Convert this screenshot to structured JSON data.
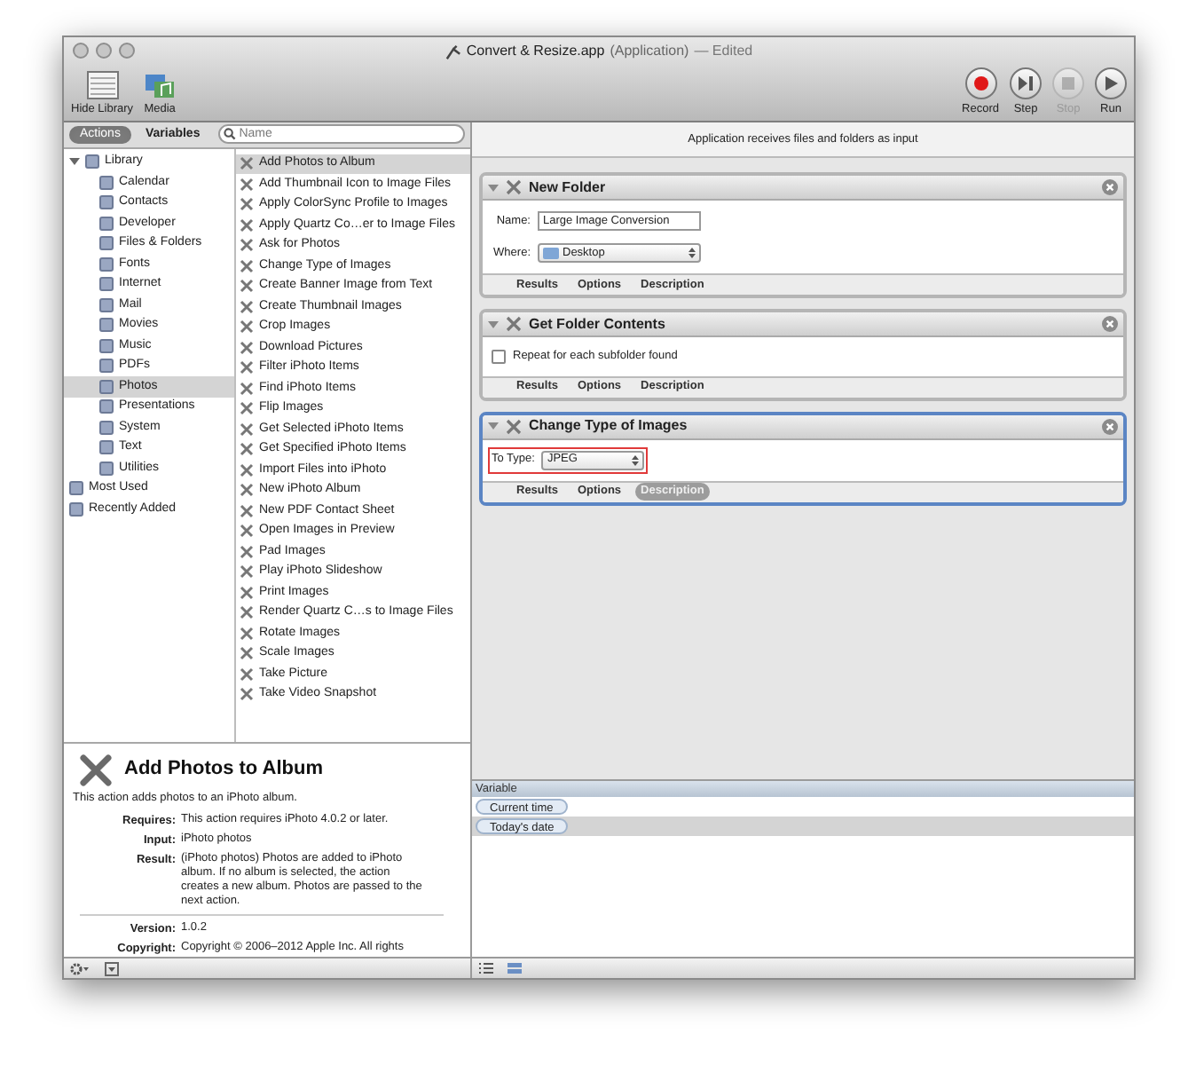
{
  "window": {
    "title": "Convert & Resize.app",
    "subtitle": "(Application)",
    "status": "— Edited"
  },
  "toolbar": {
    "left": [
      {
        "label": "Hide Library",
        "kind": "library"
      },
      {
        "label": "Media",
        "kind": "media"
      }
    ],
    "right": [
      {
        "label": "Record",
        "kind": "record",
        "disabled": false
      },
      {
        "label": "Step",
        "kind": "step",
        "disabled": false
      },
      {
        "label": "Stop",
        "kind": "stop",
        "disabled": true
      },
      {
        "label": "Run",
        "kind": "run",
        "disabled": false
      }
    ]
  },
  "tabs": [
    {
      "label": "Actions",
      "selected": true
    },
    {
      "label": "Variables",
      "selected": false
    }
  ],
  "search": {
    "placeholder": "Name"
  },
  "library": [
    {
      "label": "Library",
      "expanded": true,
      "selected": false,
      "children": [
        {
          "label": "Calendar",
          "selected": false
        },
        {
          "label": "Contacts",
          "selected": false
        },
        {
          "label": "Developer",
          "selected": false
        },
        {
          "label": "Files & Folders",
          "selected": false
        },
        {
          "label": "Fonts",
          "selected": false
        },
        {
          "label": "Internet",
          "selected": false
        },
        {
          "label": "Mail",
          "selected": false
        },
        {
          "label": "Movies",
          "selected": false
        },
        {
          "label": "Music",
          "selected": false
        },
        {
          "label": "PDFs",
          "selected": false
        },
        {
          "label": "Photos",
          "selected": true
        },
        {
          "label": "Presentations",
          "selected": false
        },
        {
          "label": "System",
          "selected": false
        },
        {
          "label": "Text",
          "selected": false
        },
        {
          "label": "Utilities",
          "selected": false
        }
      ]
    },
    {
      "label": "Most Used",
      "selected": false
    },
    {
      "label": "Recently Added",
      "selected": false
    }
  ],
  "actions": [
    {
      "label": "Add Photos to Album",
      "selected": true
    },
    {
      "label": "Add Thumbnail Icon to Image Files",
      "selected": false
    },
    {
      "label": "Apply ColorSync Profile to Images",
      "selected": false
    },
    {
      "label": "Apply Quartz Co…er to Image Files",
      "selected": false
    },
    {
      "label": "Ask for Photos",
      "selected": false
    },
    {
      "label": "Change Type of Images",
      "selected": false
    },
    {
      "label": "Create Banner Image from Text",
      "selected": false
    },
    {
      "label": "Create Thumbnail Images",
      "selected": false
    },
    {
      "label": "Crop Images",
      "selected": false
    },
    {
      "label": "Download Pictures",
      "selected": false
    },
    {
      "label": "Filter iPhoto Items",
      "selected": false
    },
    {
      "label": "Find iPhoto Items",
      "selected": false
    },
    {
      "label": "Flip Images",
      "selected": false
    },
    {
      "label": "Get Selected iPhoto Items",
      "selected": false
    },
    {
      "label": "Get Specified iPhoto Items",
      "selected": false
    },
    {
      "label": "Import Files into iPhoto",
      "selected": false
    },
    {
      "label": "New iPhoto Album",
      "selected": false
    },
    {
      "label": "New PDF Contact Sheet",
      "selected": false
    },
    {
      "label": "Open Images in Preview",
      "selected": false
    },
    {
      "label": "Pad Images",
      "selected": false
    },
    {
      "label": "Play iPhoto Slideshow",
      "selected": false
    },
    {
      "label": "Print Images",
      "selected": false
    },
    {
      "label": "Render Quartz C…s to Image Files",
      "selected": false
    },
    {
      "label": "Rotate Images",
      "selected": false
    },
    {
      "label": "Scale Images",
      "selected": false
    },
    {
      "label": "Take Picture",
      "selected": false
    },
    {
      "label": "Take Video Snapshot",
      "selected": false
    }
  ],
  "description": {
    "title": "Add Photos to Album",
    "summary": "This action adds photos to an iPhoto album.",
    "fields": [
      {
        "label": "Requires:",
        "value": "This action requires iPhoto 4.0.2 or later."
      },
      {
        "label": "Input:",
        "value": "iPhoto photos"
      },
      {
        "label": "Result:",
        "value": "(iPhoto photos) Photos are added to iPhoto album. If no album is selected, the action creates a new album. Photos are passed to the next action."
      }
    ],
    "version": {
      "label": "Version:",
      "value": "1.0.2"
    },
    "copyright": {
      "label": "Copyright:",
      "value": "Copyright © 2006–2012 Apple Inc.  All rights"
    }
  },
  "workflow": {
    "header": "Application receives files and folders as input",
    "steps": [
      {
        "title": "New Folder",
        "selected": false,
        "fields": [
          {
            "kind": "text",
            "label": "Name:",
            "value": "Large Image Conversion"
          },
          {
            "kind": "popup",
            "label": "Where:",
            "value": "Desktop",
            "folder": true
          }
        ],
        "footer": [
          {
            "label": "Results",
            "selected": false
          },
          {
            "label": "Options",
            "selected": false
          },
          {
            "label": "Description",
            "selected": false
          }
        ]
      },
      {
        "title": "Get Folder Contents",
        "selected": false,
        "fields": [
          {
            "kind": "checkbox",
            "label": "Repeat for each subfolder found",
            "checked": false
          }
        ],
        "footer": [
          {
            "label": "Results",
            "selected": false
          },
          {
            "label": "Options",
            "selected": false
          },
          {
            "label": "Description",
            "selected": false
          }
        ]
      },
      {
        "title": "Change Type of Images",
        "selected": true,
        "fields": [
          {
            "kind": "popup",
            "label": "To Type:",
            "value": "JPEG",
            "folder": false,
            "highlighted": true
          }
        ],
        "footer": [
          {
            "label": "Results",
            "selected": false
          },
          {
            "label": "Options",
            "selected": false
          },
          {
            "label": "Description",
            "selected": true
          }
        ]
      }
    ]
  },
  "variables": {
    "column": "Variable",
    "rows": [
      {
        "label": "Current time",
        "selected": false
      },
      {
        "label": "Today's date",
        "selected": true
      }
    ]
  }
}
